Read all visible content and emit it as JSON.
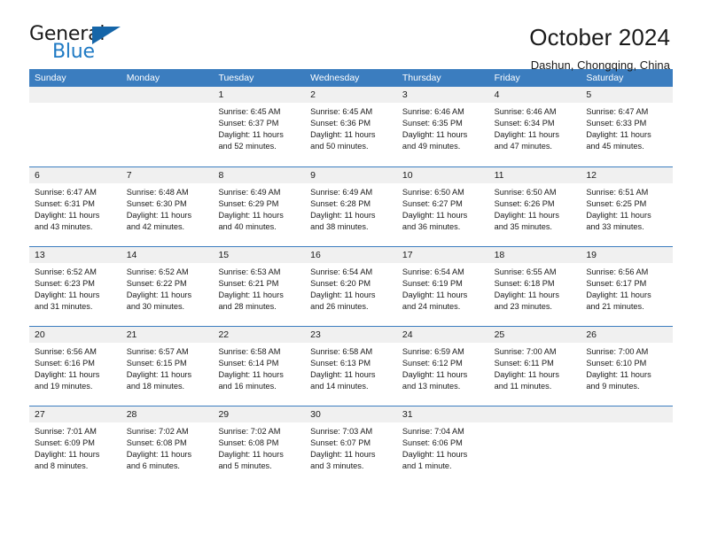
{
  "brand": {
    "name_part1": "General",
    "name_part2": "Blue",
    "triangle_icon": "triangle-icon",
    "accent_color": "#1f7ac4",
    "header_color": "#3b7dbf"
  },
  "header": {
    "title": "October 2024",
    "subtitle": "Dashun, Chongqing, China"
  },
  "weekdays": [
    "Sunday",
    "Monday",
    "Tuesday",
    "Wednesday",
    "Thursday",
    "Friday",
    "Saturday"
  ],
  "weeks": [
    [
      {
        "day": "",
        "sunrise": "",
        "sunset": "",
        "daylight_line1": "",
        "daylight_line2": ""
      },
      {
        "day": "",
        "sunrise": "",
        "sunset": "",
        "daylight_line1": "",
        "daylight_line2": ""
      },
      {
        "day": "1",
        "sunrise": "Sunrise: 6:45 AM",
        "sunset": "Sunset: 6:37 PM",
        "daylight_line1": "Daylight: 11 hours",
        "daylight_line2": "and 52 minutes."
      },
      {
        "day": "2",
        "sunrise": "Sunrise: 6:45 AM",
        "sunset": "Sunset: 6:36 PM",
        "daylight_line1": "Daylight: 11 hours",
        "daylight_line2": "and 50 minutes."
      },
      {
        "day": "3",
        "sunrise": "Sunrise: 6:46 AM",
        "sunset": "Sunset: 6:35 PM",
        "daylight_line1": "Daylight: 11 hours",
        "daylight_line2": "and 49 minutes."
      },
      {
        "day": "4",
        "sunrise": "Sunrise: 6:46 AM",
        "sunset": "Sunset: 6:34 PM",
        "daylight_line1": "Daylight: 11 hours",
        "daylight_line2": "and 47 minutes."
      },
      {
        "day": "5",
        "sunrise": "Sunrise: 6:47 AM",
        "sunset": "Sunset: 6:33 PM",
        "daylight_line1": "Daylight: 11 hours",
        "daylight_line2": "and 45 minutes."
      }
    ],
    [
      {
        "day": "6",
        "sunrise": "Sunrise: 6:47 AM",
        "sunset": "Sunset: 6:31 PM",
        "daylight_line1": "Daylight: 11 hours",
        "daylight_line2": "and 43 minutes."
      },
      {
        "day": "7",
        "sunrise": "Sunrise: 6:48 AM",
        "sunset": "Sunset: 6:30 PM",
        "daylight_line1": "Daylight: 11 hours",
        "daylight_line2": "and 42 minutes."
      },
      {
        "day": "8",
        "sunrise": "Sunrise: 6:49 AM",
        "sunset": "Sunset: 6:29 PM",
        "daylight_line1": "Daylight: 11 hours",
        "daylight_line2": "and 40 minutes."
      },
      {
        "day": "9",
        "sunrise": "Sunrise: 6:49 AM",
        "sunset": "Sunset: 6:28 PM",
        "daylight_line1": "Daylight: 11 hours",
        "daylight_line2": "and 38 minutes."
      },
      {
        "day": "10",
        "sunrise": "Sunrise: 6:50 AM",
        "sunset": "Sunset: 6:27 PM",
        "daylight_line1": "Daylight: 11 hours",
        "daylight_line2": "and 36 minutes."
      },
      {
        "day": "11",
        "sunrise": "Sunrise: 6:50 AM",
        "sunset": "Sunset: 6:26 PM",
        "daylight_line1": "Daylight: 11 hours",
        "daylight_line2": "and 35 minutes."
      },
      {
        "day": "12",
        "sunrise": "Sunrise: 6:51 AM",
        "sunset": "Sunset: 6:25 PM",
        "daylight_line1": "Daylight: 11 hours",
        "daylight_line2": "and 33 minutes."
      }
    ],
    [
      {
        "day": "13",
        "sunrise": "Sunrise: 6:52 AM",
        "sunset": "Sunset: 6:23 PM",
        "daylight_line1": "Daylight: 11 hours",
        "daylight_line2": "and 31 minutes."
      },
      {
        "day": "14",
        "sunrise": "Sunrise: 6:52 AM",
        "sunset": "Sunset: 6:22 PM",
        "daylight_line1": "Daylight: 11 hours",
        "daylight_line2": "and 30 minutes."
      },
      {
        "day": "15",
        "sunrise": "Sunrise: 6:53 AM",
        "sunset": "Sunset: 6:21 PM",
        "daylight_line1": "Daylight: 11 hours",
        "daylight_line2": "and 28 minutes."
      },
      {
        "day": "16",
        "sunrise": "Sunrise: 6:54 AM",
        "sunset": "Sunset: 6:20 PM",
        "daylight_line1": "Daylight: 11 hours",
        "daylight_line2": "and 26 minutes."
      },
      {
        "day": "17",
        "sunrise": "Sunrise: 6:54 AM",
        "sunset": "Sunset: 6:19 PM",
        "daylight_line1": "Daylight: 11 hours",
        "daylight_line2": "and 24 minutes."
      },
      {
        "day": "18",
        "sunrise": "Sunrise: 6:55 AM",
        "sunset": "Sunset: 6:18 PM",
        "daylight_line1": "Daylight: 11 hours",
        "daylight_line2": "and 23 minutes."
      },
      {
        "day": "19",
        "sunrise": "Sunrise: 6:56 AM",
        "sunset": "Sunset: 6:17 PM",
        "daylight_line1": "Daylight: 11 hours",
        "daylight_line2": "and 21 minutes."
      }
    ],
    [
      {
        "day": "20",
        "sunrise": "Sunrise: 6:56 AM",
        "sunset": "Sunset: 6:16 PM",
        "daylight_line1": "Daylight: 11 hours",
        "daylight_line2": "and 19 minutes."
      },
      {
        "day": "21",
        "sunrise": "Sunrise: 6:57 AM",
        "sunset": "Sunset: 6:15 PM",
        "daylight_line1": "Daylight: 11 hours",
        "daylight_line2": "and 18 minutes."
      },
      {
        "day": "22",
        "sunrise": "Sunrise: 6:58 AM",
        "sunset": "Sunset: 6:14 PM",
        "daylight_line1": "Daylight: 11 hours",
        "daylight_line2": "and 16 minutes."
      },
      {
        "day": "23",
        "sunrise": "Sunrise: 6:58 AM",
        "sunset": "Sunset: 6:13 PM",
        "daylight_line1": "Daylight: 11 hours",
        "daylight_line2": "and 14 minutes."
      },
      {
        "day": "24",
        "sunrise": "Sunrise: 6:59 AM",
        "sunset": "Sunset: 6:12 PM",
        "daylight_line1": "Daylight: 11 hours",
        "daylight_line2": "and 13 minutes."
      },
      {
        "day": "25",
        "sunrise": "Sunrise: 7:00 AM",
        "sunset": "Sunset: 6:11 PM",
        "daylight_line1": "Daylight: 11 hours",
        "daylight_line2": "and 11 minutes."
      },
      {
        "day": "26",
        "sunrise": "Sunrise: 7:00 AM",
        "sunset": "Sunset: 6:10 PM",
        "daylight_line1": "Daylight: 11 hours",
        "daylight_line2": "and 9 minutes."
      }
    ],
    [
      {
        "day": "27",
        "sunrise": "Sunrise: 7:01 AM",
        "sunset": "Sunset: 6:09 PM",
        "daylight_line1": "Daylight: 11 hours",
        "daylight_line2": "and 8 minutes."
      },
      {
        "day": "28",
        "sunrise": "Sunrise: 7:02 AM",
        "sunset": "Sunset: 6:08 PM",
        "daylight_line1": "Daylight: 11 hours",
        "daylight_line2": "and 6 minutes."
      },
      {
        "day": "29",
        "sunrise": "Sunrise: 7:02 AM",
        "sunset": "Sunset: 6:08 PM",
        "daylight_line1": "Daylight: 11 hours",
        "daylight_line2": "and 5 minutes."
      },
      {
        "day": "30",
        "sunrise": "Sunrise: 7:03 AM",
        "sunset": "Sunset: 6:07 PM",
        "daylight_line1": "Daylight: 11 hours",
        "daylight_line2": "and 3 minutes."
      },
      {
        "day": "31",
        "sunrise": "Sunrise: 7:04 AM",
        "sunset": "Sunset: 6:06 PM",
        "daylight_line1": "Daylight: 11 hours",
        "daylight_line2": "and 1 minute."
      },
      {
        "day": "",
        "sunrise": "",
        "sunset": "",
        "daylight_line1": "",
        "daylight_line2": ""
      },
      {
        "day": "",
        "sunrise": "",
        "sunset": "",
        "daylight_line1": "",
        "daylight_line2": ""
      }
    ]
  ]
}
